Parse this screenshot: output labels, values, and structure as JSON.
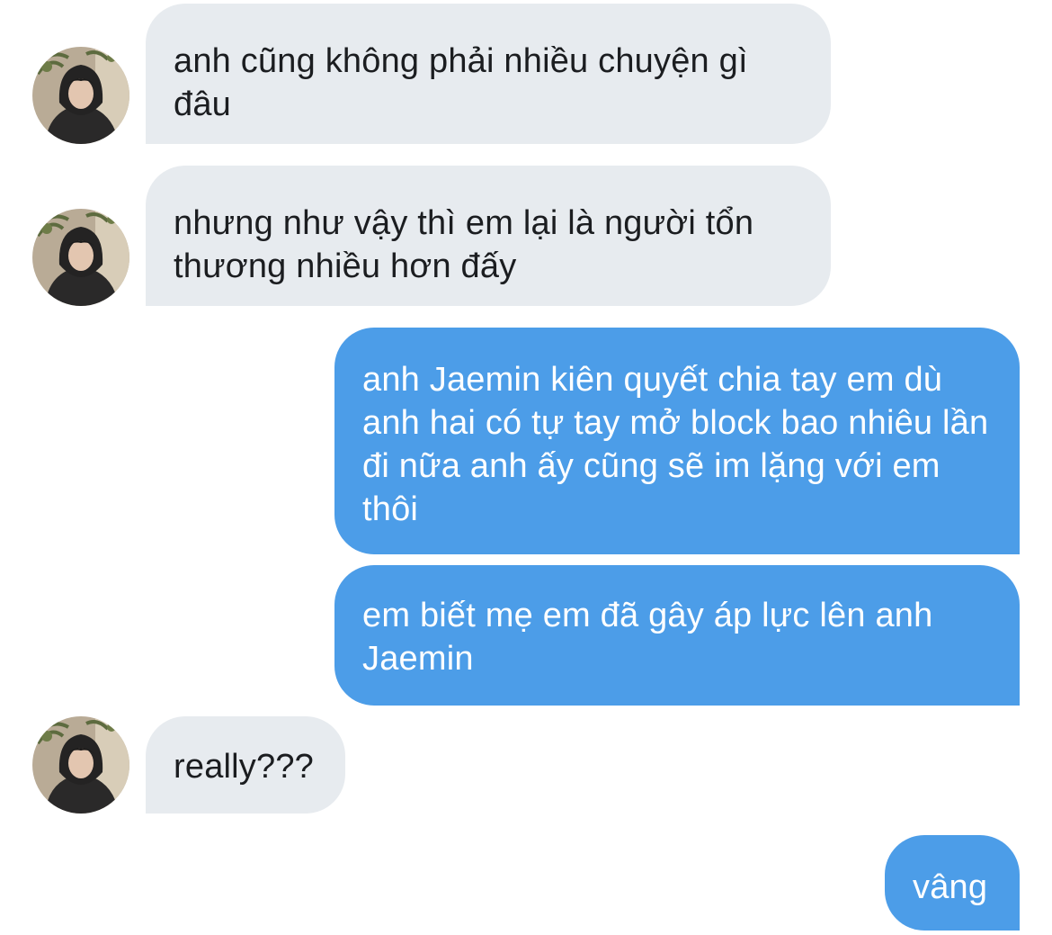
{
  "conversation": {
    "messages": [
      {
        "direction": "received",
        "text": "anh cũng không phải nhiều chuyện gì đâu",
        "avatar_icon": "contact-avatar-icon"
      },
      {
        "direction": "received",
        "text": "nhưng như vậy thì em lại là người tổn thương nhiều hơn đấy",
        "avatar_icon": "contact-avatar-icon"
      },
      {
        "direction": "sent",
        "text": "anh Jaemin kiên quyết chia tay em dù anh hai có tự tay mở block bao nhiêu lần đi nữa anh ấy cũng sẽ im lặng với em thôi"
      },
      {
        "direction": "sent",
        "text": "em biết mẹ em đã gây áp lực lên anh Jaemin"
      },
      {
        "direction": "received",
        "text": "really???",
        "avatar_icon": "contact-avatar-icon"
      },
      {
        "direction": "sent",
        "text": "vâng"
      }
    ]
  },
  "theme": {
    "received_bubble": "#e7ebef",
    "received_text": "#1b1d20",
    "sent_bubble": "#4c9de8",
    "sent_text": "#ffffff",
    "background": "#ffffff"
  }
}
